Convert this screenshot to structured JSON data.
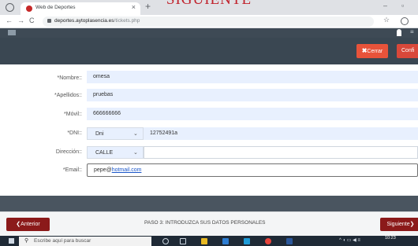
{
  "overlay": {
    "title": "SIGUIENTE"
  },
  "browser": {
    "tab_title": "Web de Deportes",
    "url_host": "deportes.aytoplasencia.es",
    "url_path": "/tickets.php"
  },
  "header": {
    "cerrar_label": "Cerrar",
    "confirmar_label": "Confi"
  },
  "form": {
    "nombre": {
      "label": "*Nombre::",
      "value": "omesa"
    },
    "apellidos": {
      "label": "*Apellidos::",
      "value": "pruebas"
    },
    "movil": {
      "label": "*Móvil::",
      "value": "666666666"
    },
    "dni": {
      "label": "*DNI::",
      "type": "Dni",
      "value": "12752491a"
    },
    "direccion": {
      "label": "Dirección::",
      "type": "CALLE",
      "value": ""
    },
    "email": {
      "label": "*Email::",
      "prefix": "pepe@",
      "link": "hotmail.com"
    }
  },
  "footer": {
    "anterior_label": "Anterior",
    "paso_text": "PASO 3: INTRODUZCA SUS DATOS PERSONALES",
    "siguiente_label": "Siguiente"
  },
  "taskbar": {
    "search_placeholder": "Escribe aquí para buscar",
    "time": "10:23"
  },
  "colors": {
    "header_dark": "#3a4752",
    "cerrar": "#e8533a",
    "nav_button": "#8b1a1a",
    "input_bg": "#e8f0fe",
    "overlay_title": "#c0202a"
  },
  "icons": {
    "browser": [
      "reload-icon",
      "favicon-icon",
      "close-icon",
      "new-tab-icon",
      "back-icon",
      "forward-icon",
      "lock-icon",
      "star-icon",
      "profile-icon",
      "minimize-icon",
      "maximize-icon"
    ],
    "taskbar": [
      "windows-start-icon",
      "search-icon",
      "cortana-icon",
      "task-view-icon",
      "file-explorer-icon",
      "store-icon",
      "edge-icon",
      "chrome-icon",
      "word-icon"
    ]
  }
}
